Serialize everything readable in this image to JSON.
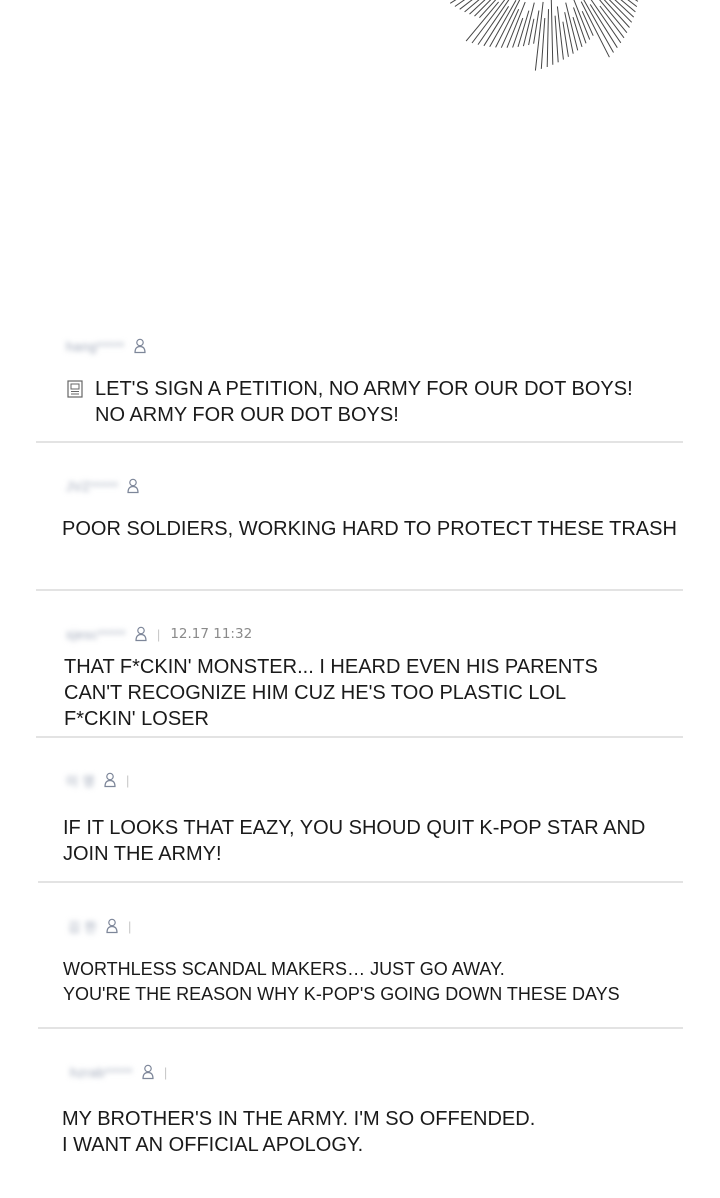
{
  "comments": [
    {
      "user": "hang*****",
      "icons": [
        "document-icon"
      ],
      "lines": [
        "LET'S SIGN A PETITION, NO ARMY FOR OUR DOT BOYS!",
        "NO ARMY FOR OUR DOT BOYS!"
      ]
    },
    {
      "user": "JVZ*****",
      "lines": [
        "POOR SOLDIERS, WORKING HARD TO PROTECT THESE TRASH"
      ]
    },
    {
      "user": "sjesc*****",
      "separator": "|",
      "timestamp": "12.17 11:32",
      "lines": [
        "THAT F*CKIN' MONSTER... I HEARD EVEN HIS PARENTS",
        "CAN'T RECOGNIZE HIM CUZ HE'S TOO PLASTIC LOL",
        "F*CKIN' LOSER"
      ]
    },
    {
      "user": "이 영",
      "separator": "|",
      "lines": [
        "IF IT LOOKS THAT EAZY, YOU SHOUD QUIT K-POP STAR AND",
        "JOIN THE ARMY!"
      ]
    },
    {
      "user": "김 한",
      "separator": "|",
      "lines": [
        "WORTHLESS SCANDAL MAKERS… JUST GO AWAY.",
        "YOU'RE THE REASON WHY K-POP'S GOING DOWN THESE DAYS"
      ]
    },
    {
      "user": "hzrab*****",
      "separator": "|",
      "lines": [
        "MY BROTHER'S IN THE ARMY. I'M SO OFFENDED.",
        "I WANT AN OFFICIAL APOLOGY."
      ]
    }
  ],
  "colors": {
    "divider": "#e3e3e3",
    "username": "#9aa3b5",
    "user_icon": "#7d8699",
    "text": "#1a1a1a"
  }
}
